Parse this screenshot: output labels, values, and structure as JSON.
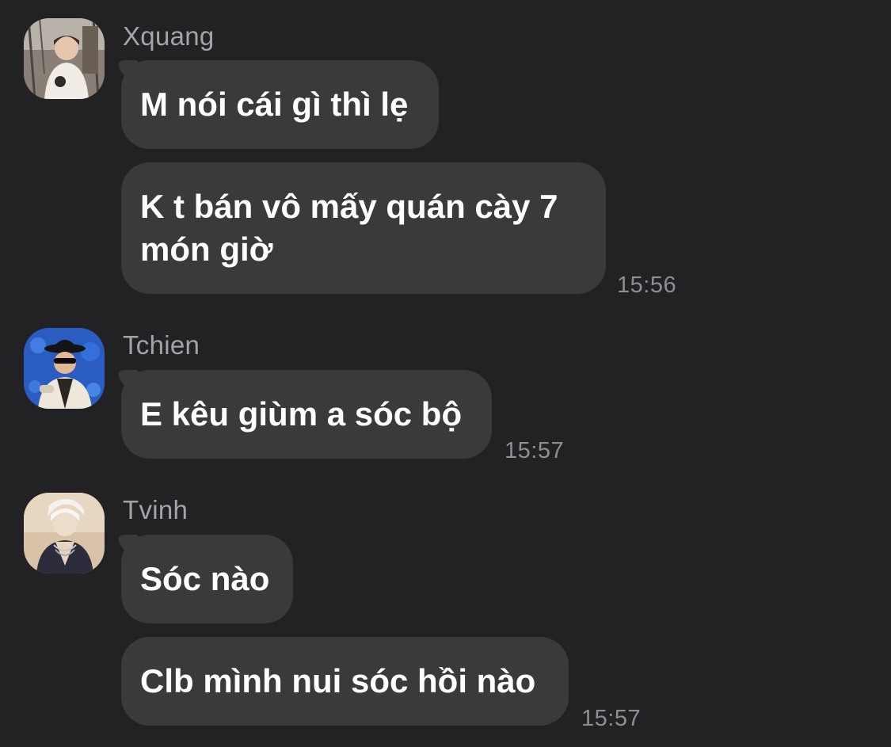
{
  "messages": [
    {
      "sender": "Xquang",
      "avatar_icon": "user-avatar-photo",
      "bubbles": [
        "M nói cái gì thì lẹ",
        "K t bán vô mấy quán cày 7 món giờ"
      ],
      "time": "15:56"
    },
    {
      "sender": "Tchien",
      "avatar_icon": "user-avatar-photo",
      "bubbles": [
        "E kêu giùm a sóc bộ"
      ],
      "time": "15:57"
    },
    {
      "sender": "Tvinh",
      "avatar_icon": "user-avatar-photo",
      "bubbles": [
        "Sóc nào",
        "Clb mình nui sóc hồi nào"
      ],
      "time": "15:57"
    }
  ],
  "colors": {
    "background": "#222124",
    "bubble": "#3a3a3d",
    "sender_name": "#a3a3a8",
    "timestamp": "#8e8e93",
    "message_text": "#ffffff"
  }
}
